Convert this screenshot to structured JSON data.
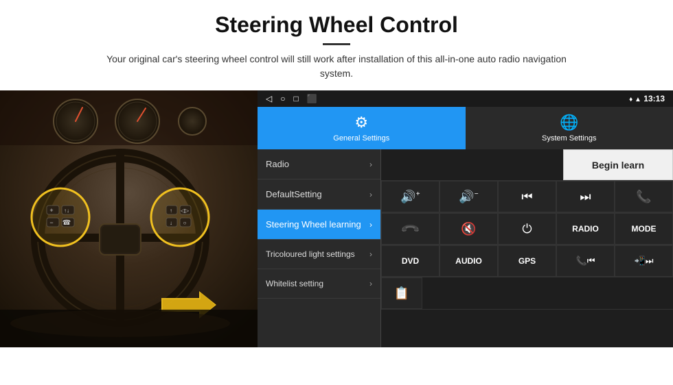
{
  "header": {
    "title": "Steering Wheel Control",
    "subtitle": "Your original car's steering wheel control will still work after installation of this all-in-one auto radio navigation system."
  },
  "status_bar": {
    "time": "13:13",
    "icons": [
      "◁",
      "○",
      "□",
      "⬛"
    ]
  },
  "tabs": [
    {
      "id": "general",
      "label": "General Settings",
      "icon": "⚙",
      "active": true
    },
    {
      "id": "system",
      "label": "System Settings",
      "icon": "🌐",
      "active": false
    }
  ],
  "menu": {
    "items": [
      {
        "label": "Radio",
        "active": false
      },
      {
        "label": "DefaultSetting",
        "active": false
      },
      {
        "label": "Steering Wheel learning",
        "active": true
      },
      {
        "label": "Tricoloured light settings",
        "active": false
      },
      {
        "label": "Whitelist setting",
        "active": false
      }
    ]
  },
  "right_panel": {
    "begin_learn_label": "Begin learn",
    "controls_row1": [
      "🔊+",
      "🔊−",
      "⏮",
      "⏭",
      "📞"
    ],
    "controls_row2": [
      "📞",
      "🔊×",
      "⏻",
      "RADIO",
      "MODE"
    ],
    "controls_row3": [
      "DVD",
      "AUDIO",
      "GPS",
      "📞⏮",
      "📲⏭"
    ],
    "last_row_icon": "📋"
  }
}
